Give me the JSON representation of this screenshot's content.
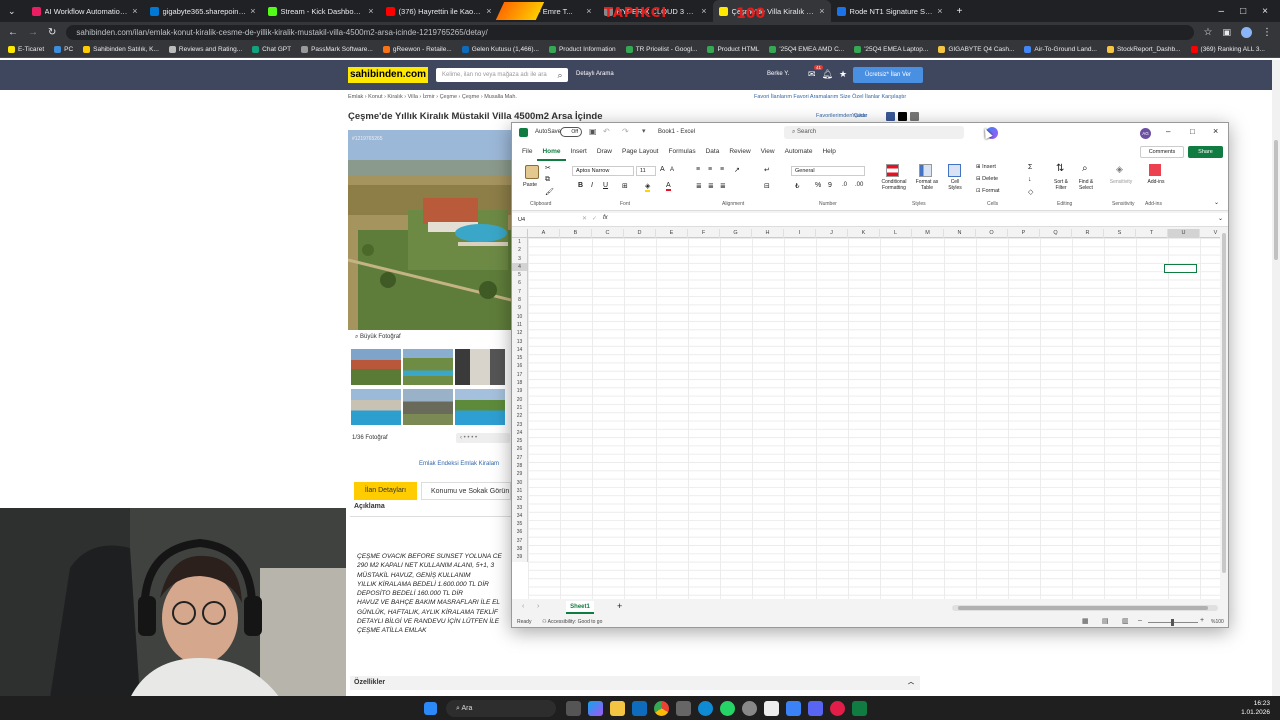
{
  "browser": {
    "tabs": [
      {
        "title": "AI Workflow Automation Platf...",
        "color": "#e91e63"
      },
      {
        "title": "gigabyte365.sharepoint.com/si...",
        "color": "#0078d4"
      },
      {
        "title": "Stream - Kick Dashboard",
        "color": "#53fc18"
      },
      {
        "title": "(376) Hayrettin ile Kaos Show...",
        "color": "#ff0000"
      },
      {
        "title": "Detay - Emre T...",
        "color": "#ffe800"
      },
      {
        "title": "HYPER X CLOUD 3 S Wireless ...",
        "color": "#888888"
      },
      {
        "title": "Çeşme'de Villa Kiralık Müstakil ...",
        "color": "#ffe800"
      },
      {
        "title": "Rode NT1 Signature Series Stu...",
        "color": "#1a73e8"
      }
    ],
    "overlay_text_1": "TAPIKCI",
    "overlay_text_2": "100",
    "url": "sahibinden.com/ilan/emlak-konut-kiralik-cesme-de-yillik-kiralik-mustakil-villa-4500m2-arsa-icinde-1219765265/detay/",
    "bookmarks": [
      "E-Ticaret",
      "PC",
      "Sahibinden Satılık, K...",
      "Reviews and Rating...",
      "Chat GPT",
      "PassMark Software...",
      "gReewon - Retaile...",
      "Gelen Kutusu (1,466)...",
      "Product Information",
      "TR Pricelist - Googl...",
      "Product HTML",
      "'25Q4 EMEA AMD C...",
      "'25Q4 EMEA Laptop...",
      "GIGABYTE Q4 Cash...",
      "Air-To-Ground Land...",
      "StockReport_Dashb...",
      "(369) Ranking ALL 3..."
    ]
  },
  "site": {
    "logo": "sahibinden.com",
    "search_placeholder": "Kelime, ilan no veya mağaza adı ile ara",
    "detail_search": "Detaylı Arama",
    "user_name": "Berke Y.",
    "notif_count": "41",
    "post_ad": "Ücretsiz* İlan Ver",
    "breadcrumb": "Emlak › Konut › Kiralık › Villa › İzmir › Çeşme › Çeşme › Musalla Mah.",
    "top_links": "Favori İlanlarım   Favori Aramalarım   Size Özel İlanlar   Karşılaştır",
    "fav_link": "Favorilerimden Çıkar",
    "print_link": "Yazdır",
    "title": "Çeşme'de Yıllık Kiralık Müstakil Villa 4500m2 Arsa İçinde",
    "photo_id": "#1219765265",
    "big_photo": "Büyük Fotoğraf",
    "photo_count": "1/36 Fotoğraf",
    "links_row": "Emlak Endeksi    Emlak Kiralam",
    "tab_details": "İlan Detayları",
    "tab_location": "Konumu ve Sokak Görün",
    "desc_head": "Açıklama",
    "description": [
      "ÇEŞME OVACIK BEFORE SUNSET YOLUNA CE",
      "290 m2 KAPALI NET KULLANIM ALANI, 5+1, 3",
      "MÜSTAKİL HAVUZ, GENİŞ KULLANIM",
      "YILLIK KİRALAMA BEDELİ 1.600.000 TL DİR",
      "DEPOSİTO BEDELİ 160.000 TL DİR",
      "HAVUZ VE BAHÇE BAKIM MASRAFLARI İLE EL",
      "GÜNLÜK, HAFTALIK, AYLIK KİRALAMA TEKLİF",
      "DETAYLI BİLGİ VE RANDEVU İÇİN LÜTFEN İLE",
      "ÇEŞME ATİLLA EMLAK"
    ],
    "features": "Özellikler"
  },
  "excel": {
    "autosave": "AutoSave",
    "autosave_state": "Off",
    "title": "Book1 - Excel",
    "search": "Search",
    "avatar": "AG",
    "tabs": [
      "File",
      "Home",
      "Insert",
      "Draw",
      "Page Layout",
      "Formulas",
      "Data",
      "Review",
      "View",
      "Automate",
      "Help"
    ],
    "comments": "Comments",
    "share": "Share",
    "font_name": "Aptos Narrow",
    "font_size": "11",
    "number_format": "General",
    "paste": "Paste",
    "conditional": "Conditional Formatting",
    "format_table": "Format as Table",
    "cell_styles": "Cell Styles",
    "insert": "Insert",
    "delete": "Delete",
    "format": "Format",
    "sort_filter": "Sort & Filter",
    "find_select": "Find & Select",
    "sensitivity": "Sensitivity",
    "addins": "Add-ins",
    "groups": [
      "Clipboard",
      "Font",
      "Alignment",
      "Number",
      "Styles",
      "Cells",
      "Editing",
      "Sensitivity",
      "Add-ins"
    ],
    "name_box": "U4",
    "fx": "fx",
    "columns": [
      "A",
      "B",
      "C",
      "D",
      "E",
      "F",
      "G",
      "H",
      "I",
      "J",
      "K",
      "L",
      "M",
      "N",
      "O",
      "P",
      "Q",
      "R",
      "S",
      "T",
      "U",
      "V"
    ],
    "rows": [
      "1",
      "2",
      "3",
      "4",
      "5",
      "6",
      "7",
      "8",
      "9",
      "10",
      "11",
      "12",
      "13",
      "14",
      "15",
      "16",
      "17",
      "18",
      "19",
      "20",
      "21",
      "22",
      "23",
      "24",
      "25",
      "26",
      "27",
      "28",
      "29",
      "30",
      "31",
      "32",
      "33",
      "34",
      "35",
      "36",
      "37",
      "38",
      "39"
    ],
    "sheet": "Sheet1",
    "status_ready": "Ready",
    "status_access": "Accessibility: Good to go",
    "zoom": "%100"
  },
  "taskbar": {
    "search": "Ara",
    "time": "16:23",
    "date": "1.01.2026"
  }
}
